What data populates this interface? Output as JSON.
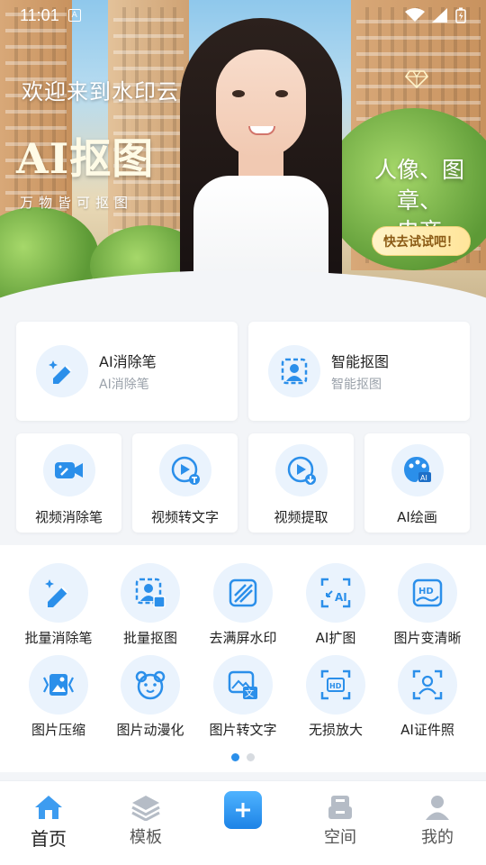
{
  "status_bar": {
    "time": "11:01",
    "notification_icon": "A"
  },
  "banner": {
    "welcome": "欢迎来到水印云",
    "title": "AI抠图",
    "subtitle": "万物皆可抠图",
    "slogan_line1": "人像、图章、",
    "slogan_line2": "电商",
    "cta": "快去试试吧！"
  },
  "big_cards": [
    {
      "title": "AI消除笔",
      "subtitle": "AI消除笔",
      "icon": "eraser-pen-icon"
    },
    {
      "title": "智能抠图",
      "subtitle": "智能抠图",
      "icon": "portrait-cutout-icon"
    }
  ],
  "mid_cards": [
    {
      "label": "视频消除笔",
      "icon": "video-eraser-icon"
    },
    {
      "label": "视频转文字",
      "icon": "video-to-text-icon"
    },
    {
      "label": "视频提取",
      "icon": "video-extract-icon"
    },
    {
      "label": "AI绘画",
      "icon": "ai-palette-icon"
    }
  ],
  "tools": [
    {
      "label": "批量消除笔",
      "icon": "batch-eraser-icon"
    },
    {
      "label": "批量抠图",
      "icon": "batch-cutout-icon"
    },
    {
      "label": "去满屏水印",
      "icon": "remove-watermark-icon"
    },
    {
      "label": "AI扩图",
      "icon": "ai-expand-icon"
    },
    {
      "label": "图片变清晰",
      "icon": "hd-enhance-icon"
    },
    {
      "label": "图片压缩",
      "icon": "image-compress-icon"
    },
    {
      "label": "图片动漫化",
      "icon": "anime-face-icon"
    },
    {
      "label": "图片转文字",
      "icon": "image-to-text-icon"
    },
    {
      "label": "无损放大",
      "icon": "lossless-upscale-icon"
    },
    {
      "label": "AI证件照",
      "icon": "id-photo-icon"
    }
  ],
  "nav": {
    "home": "首页",
    "templates": "模板",
    "space": "空间",
    "mine": "我的"
  },
  "colors": {
    "accent": "#2b8fea",
    "icon_bg": "#eaf3fd",
    "cta_bg": "#ffe59a"
  }
}
